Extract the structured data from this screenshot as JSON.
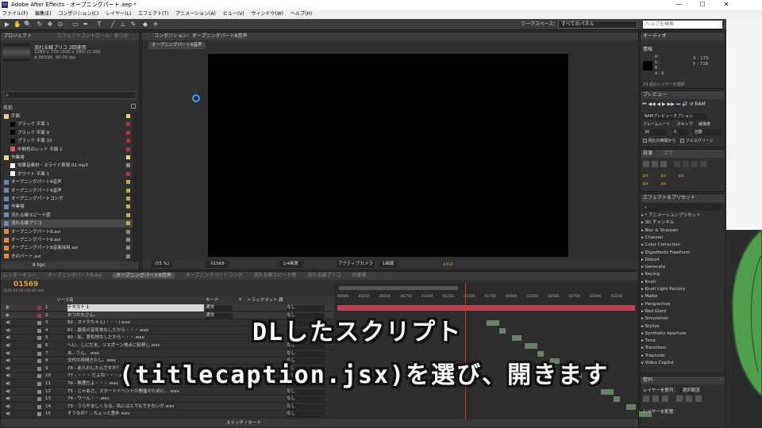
{
  "window": {
    "title": "Adobe After Effects - オープニングパート.aep *",
    "app_icon": "Ae",
    "controls": [
      "—",
      "☐",
      "✕"
    ]
  },
  "menu": [
    "ファイル(F)",
    "編集(E)",
    "コンポジション(C)",
    "レイヤー(L)",
    "エフェクト(T)",
    "アニメーション(A)",
    "ビュー(V)",
    "ウィンドウ(W)",
    "ヘルプ(H)"
  ],
  "toolbar": {
    "tools": [
      "▶",
      "✋",
      "🔍",
      "↻",
      "✥",
      "⊙",
      "▭",
      "✒",
      "T",
      "╱",
      "⊥",
      "✎",
      "◆",
      "✳"
    ],
    "workspace_label": "ワークスペース：",
    "workspace_value": "すべてのパネル",
    "search_placeholder": "ヘルプを検索"
  },
  "project_panel": {
    "tabs": [
      "プロジェクト",
      "エフェクトコントロール：おつか"
    ],
    "selected_name": "流れる線プリコ",
    "selected_usage": "2回使用",
    "selected_dims": "1280 x 720  (320 x 180) (1.00)",
    "selected_duration": "Δ 06595, 30.00 fps",
    "search_icon": "⌕",
    "col_name": "名前",
    "items": [
      {
        "label": "平面",
        "indent": 0,
        "color": "#e8d28a",
        "tag": "#e8d28a"
      },
      {
        "label": "ブラック 平面 1",
        "indent": 2,
        "color": "#000000",
        "tag": "#b03040"
      },
      {
        "label": "ブラック 平面 9",
        "indent": 2,
        "color": "#000000",
        "tag": "#b03040"
      },
      {
        "label": "ブラック 平面 10",
        "indent": 2,
        "color": "#000000",
        "tag": "#b03040"
      },
      {
        "label": "中間色のレッド 平面 1",
        "indent": 2,
        "color": "#d65a6a",
        "tag": "#b03040"
      },
      {
        "label": "作業場",
        "indent": 0,
        "color": "#e8d28a",
        "tag": "#e8d28a"
      },
      {
        "label": "効果音素材・スライド表現 02.mp3",
        "indent": 2,
        "color": "#ffffff",
        "tag": "#8a8a8a"
      },
      {
        "label": "ホワイト 平面 1",
        "indent": 2,
        "color": "#ffffff",
        "tag": "#b03040"
      },
      {
        "label": "オープニングパート8音声",
        "indent": 0,
        "color": "#6b86b5",
        "tag": "#b8b050"
      },
      {
        "label": "オープニングパート9音声",
        "indent": 0,
        "color": "#6b86b5",
        "tag": "#b8b050"
      },
      {
        "label": "オープニングパートコンポ",
        "indent": 0,
        "color": "#6b86b5",
        "tag": "#b8b050"
      },
      {
        "label": "作業場",
        "indent": 0,
        "color": "#6b86b5",
        "tag": "#b8b050"
      },
      {
        "label": "流れる線スピード感",
        "indent": 0,
        "color": "#6b86b5",
        "tag": "#b8b050"
      },
      {
        "label": "流れる線プリコ",
        "indent": 0,
        "color": "#6b86b5",
        "tag": "#b8b050"
      },
      {
        "label": "オープニングパート8.avi",
        "indent": 0,
        "color": "#e08a3a",
        "tag": "#8a8a8a"
      },
      {
        "label": "オープニングパート9.avi",
        "indent": 0,
        "color": "#e08a3a",
        "tag": "#8a8a8a"
      },
      {
        "label": "オープニングパート8音楽採用.avi",
        "indent": 0,
        "color": "#e08a3a",
        "tag": "#8a8a8a"
      },
      {
        "label": "きのパート.avi",
        "indent": 0,
        "color": "#e08a3a",
        "tag": "#8a8a8a"
      }
    ],
    "footer_bpc": "8 bpc"
  },
  "composition_panel": {
    "tab": "コンポジション：オープニングパート8音声",
    "sub_tab": "オープニングパート8音声",
    "zoom": "(55 %)",
    "timecode": "01569",
    "resolution": "1/4画質",
    "camera": "アクティブカメラ",
    "views": "1画面",
    "exposure": "+0.0"
  },
  "info_panel": {
    "tab": "オーディオ",
    "sub_tab": "情報",
    "rgba": [
      "R :",
      "G :",
      "B :",
      "A : 0"
    ],
    "x": "X : 175",
    "y": "Y : 718",
    "note": "23 個のレイヤーを選択"
  },
  "preview_panel": {
    "tab": "プレビュー",
    "controls": [
      "⏮",
      "◀◀",
      "◀",
      "▶",
      "▶▶",
      "⏭",
      "🔊",
      "↺",
      "RAM"
    ],
    "ram_option": "RAMプレビューオプション",
    "frame_rate_label": "フレームレート",
    "skip_label": "スキップ",
    "resolution_label": "解像度",
    "frame_rate_value": "30",
    "skip_value": "0",
    "resolution_value": "自動",
    "from_current": "現在の時間から",
    "full_screen": "フルスクリーン"
  },
  "paragraph_panel": {
    "tabs": [
      "段落",
      "文字"
    ],
    "px_labels": [
      "px",
      "px",
      "px",
      "px",
      "px"
    ]
  },
  "effects_panel": {
    "tab": "エフェクト＆プリセット",
    "search_placeholder": "⌕",
    "items": [
      "* アニメーションプリセット",
      "3D チャンネル",
      "Blur & Sharpen",
      "Channel",
      "Color Correction",
      "Digieffects FreeForm",
      "Distort",
      "Generate",
      "Keying",
      "Knoll",
      "Knoll Light Factory",
      "Matte",
      "Perspective",
      "Red Giant",
      "Simulation",
      "Stylize",
      "Synthetic Aperture",
      "Time",
      "Transition",
      "Trapcode",
      "Video Copilot"
    ]
  },
  "align_panel": {
    "tab": "整列",
    "label1": "レイヤーを整列：",
    "value1": "選択範囲",
    "label2": "レイヤーを配置："
  },
  "timeline": {
    "tabs": [
      "レンダーキュー",
      "オープニングパート8.avi",
      "オープニングパート8音声",
      "オープニングパートコンポ",
      "流れる線スピード感",
      "流れる線プリコ",
      "作業場"
    ],
    "timecode": "01569",
    "timecode_sub": "0:00:52:09 (30.00 fps)",
    "col_source": "ソース名",
    "col_mode": "モード",
    "col_t": "T",
    "col_track": "トラックマット",
    "col_parent": "親",
    "ruler": [
      "00000",
      "00250",
      "00500",
      "00750",
      "01000",
      "01250",
      "01500",
      "01750",
      "02000",
      "02250",
      "02500",
      "02750",
      "03000",
      "03250"
    ],
    "playhead_fraction": 0.43,
    "layers": [
      {
        "num": "1",
        "name": "テキスト 1",
        "mode": "通常",
        "parent": "なし",
        "color": "#b03040",
        "bar": "#c04050"
      },
      {
        "num": "2",
        "name": "おつかれさん。",
        "mode": "通常",
        "parent": "なし",
        "color": "#b03040",
        "bar": "#c04050"
      },
      {
        "num": "3",
        "name": "82 - スイカちゃん(・・・).wav",
        "mode": "",
        "parent": "なし",
        "color": "#8a8a8a",
        "bar": "#7aa07a"
      },
      {
        "num": "4",
        "name": "81 - 最低の音気地なしだから・・・.wav",
        "mode": "",
        "parent": "なし",
        "color": "#8a8a8a",
        "bar": "#7aa07a"
      },
      {
        "num": "5",
        "name": "80 - 私、意気地なしだから・・・.wav",
        "mode": "",
        "parent": "なし",
        "color": "#8a8a8a",
        "bar": "#7aa07a"
      },
      {
        "num": "6",
        "name": "へい、しにだま、リスポーン地点に転移し.wav",
        "mode": "",
        "parent": "なし",
        "color": "#8a8a8a",
        "bar": "#7aa07a"
      },
      {
        "num": "7",
        "name": "あ...うん。.wav",
        "mode": "",
        "parent": "なし",
        "color": "#8a8a8a",
        "bar": "#7aa07a"
      },
      {
        "num": "8",
        "name": "交代の時間きたし。wav",
        "mode": "",
        "parent": "なし",
        "color": "#8a8a8a",
        "bar": "#7aa07a"
      },
      {
        "num": "9",
        "name": "78 - あらわしたんですか？.wav",
        "mode": "",
        "parent": "なし",
        "color": "#8a8a8a",
        "bar": "#7aa07a"
      },
      {
        "num": "10",
        "name": "77 - ・・・ だよね・・・.wav",
        "mode": "",
        "parent": "なし",
        "color": "#8a8a8a",
        "bar": "#7aa07a"
      },
      {
        "num": "11",
        "name": "76 - 無理だよ・・・.wav",
        "mode": "",
        "parent": "なし",
        "color": "#8a8a8a",
        "bar": "#7aa07a"
      },
      {
        "num": "12",
        "name": "75 - じゃあさ、スタートイベントの開催のために。.wav",
        "mode": "",
        "parent": "なし",
        "color": "#8a8a8a",
        "bar": "#7aa07a"
      },
      {
        "num": "13",
        "name": "74 - ウーん・・.wav",
        "mode": "",
        "parent": "なし",
        "color": "#8a8a8a",
        "bar": "#7aa07a"
      },
      {
        "num": "14",
        "name": "73 - うらやましくなる。私にはとてもできないか.wav",
        "mode": "",
        "parent": "なし",
        "color": "#8a8a8a",
        "bar": "#7aa07a"
      },
      {
        "num": "15",
        "name": "そうなの？...ちょっと意外.wav",
        "mode": "",
        "parent": "なし",
        "color": "#8a8a8a",
        "bar": "#7aa07a"
      }
    ],
    "footer": "スイッチ / モード"
  },
  "caption": {
    "line1": "DLしたスクリプト",
    "line2": "(titlecaption.jsx)を選び、開きます"
  }
}
